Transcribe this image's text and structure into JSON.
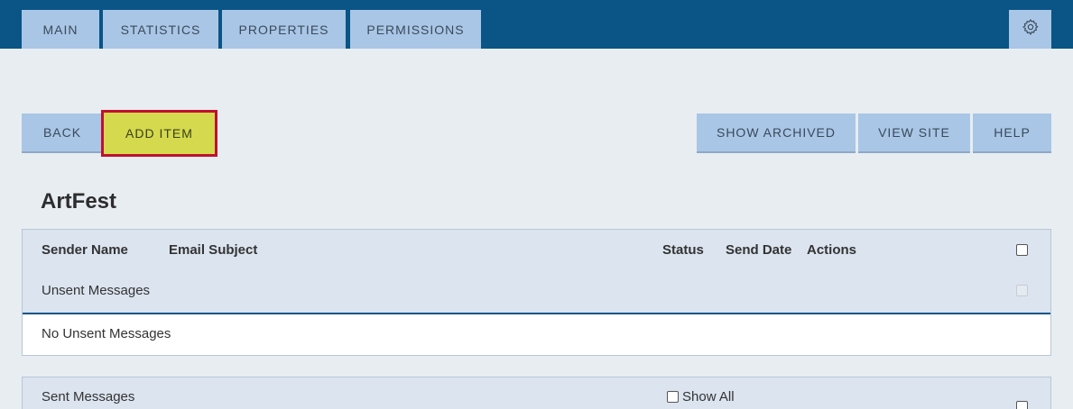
{
  "nav": {
    "tabs": [
      {
        "label": "MAIN"
      },
      {
        "label": "STATISTICS"
      },
      {
        "label": "PROPERTIES"
      },
      {
        "label": "PERMISSIONS"
      }
    ],
    "settings_icon": "gear-icon"
  },
  "toolbar": {
    "back_label": "BACK",
    "add_item_label": "ADD ITEM",
    "show_archived_label": "SHOW ARCHIVED",
    "view_site_label": "VIEW SITE",
    "help_label": "HELP"
  },
  "page": {
    "title": "ArtFest"
  },
  "table": {
    "columns": [
      "Sender Name",
      "Email Subject",
      "Status",
      "Send Date",
      "Actions"
    ],
    "unsent": {
      "section_label": "Unsent Messages",
      "empty_text": "No Unsent Messages"
    },
    "sent": {
      "section_label": "Sent Messages",
      "show_all_label": "Show All"
    }
  },
  "colors": {
    "topbar": "#0a5486",
    "tab": "#a9c6e6",
    "highlight_button": "#d4d94e",
    "highlight_border": "#c0102e",
    "panel": "#dbe4ef",
    "background": "#e8edf1"
  }
}
